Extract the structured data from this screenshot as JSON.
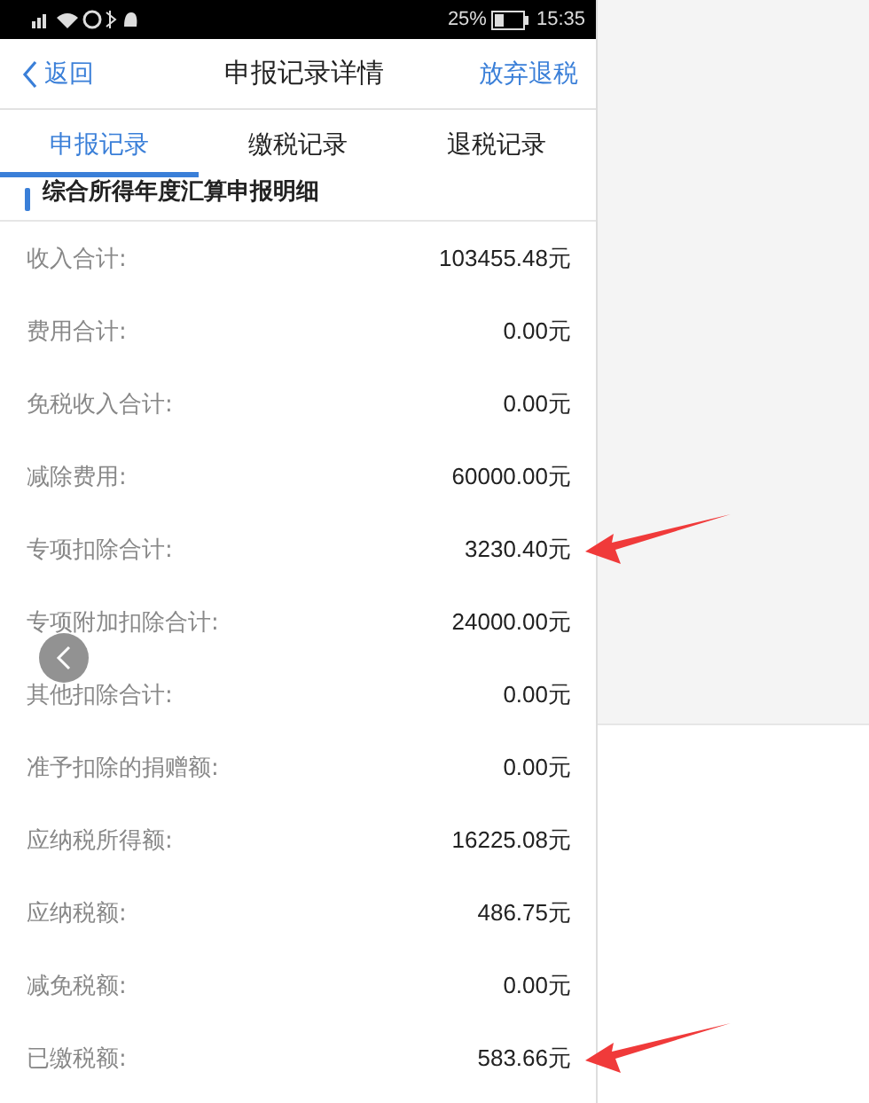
{
  "status_bar": {
    "battery": "25%",
    "time": "15:35"
  },
  "nav": {
    "back": "返回",
    "title": "申报记录详情",
    "action": "放弃退税"
  },
  "tabs": [
    {
      "label": "申报记录",
      "selected": true
    },
    {
      "label": "缴税记录",
      "selected": false
    },
    {
      "label": "退税记录",
      "selected": false
    }
  ],
  "section_title": "综合所得年度汇算申报明细",
  "rows": [
    {
      "label": "收入合计:",
      "value": "103455.48元",
      "marked": false
    },
    {
      "label": "费用合计:",
      "value": "0.00元",
      "marked": false
    },
    {
      "label": "免税收入合计:",
      "value": "0.00元",
      "marked": false
    },
    {
      "label": "减除费用:",
      "value": "60000.00元",
      "marked": false
    },
    {
      "label": "专项扣除合计:",
      "value": "3230.40元",
      "marked": true
    },
    {
      "label": "专项附加扣除合计:",
      "value": "24000.00元",
      "marked": false
    },
    {
      "label": "其他扣除合计:",
      "value": "0.00元",
      "marked": false
    },
    {
      "label": "准予扣除的捐赠额:",
      "value": "0.00元",
      "marked": false
    },
    {
      "label": "应纳税所得额:",
      "value": "16225.08元",
      "marked": false
    },
    {
      "label": "应纳税额:",
      "value": "486.75元",
      "marked": false
    },
    {
      "label": "减免税额:",
      "value": "0.00元",
      "marked": false
    },
    {
      "label": "已缴税额:",
      "value": "583.66元",
      "marked": true
    }
  ]
}
